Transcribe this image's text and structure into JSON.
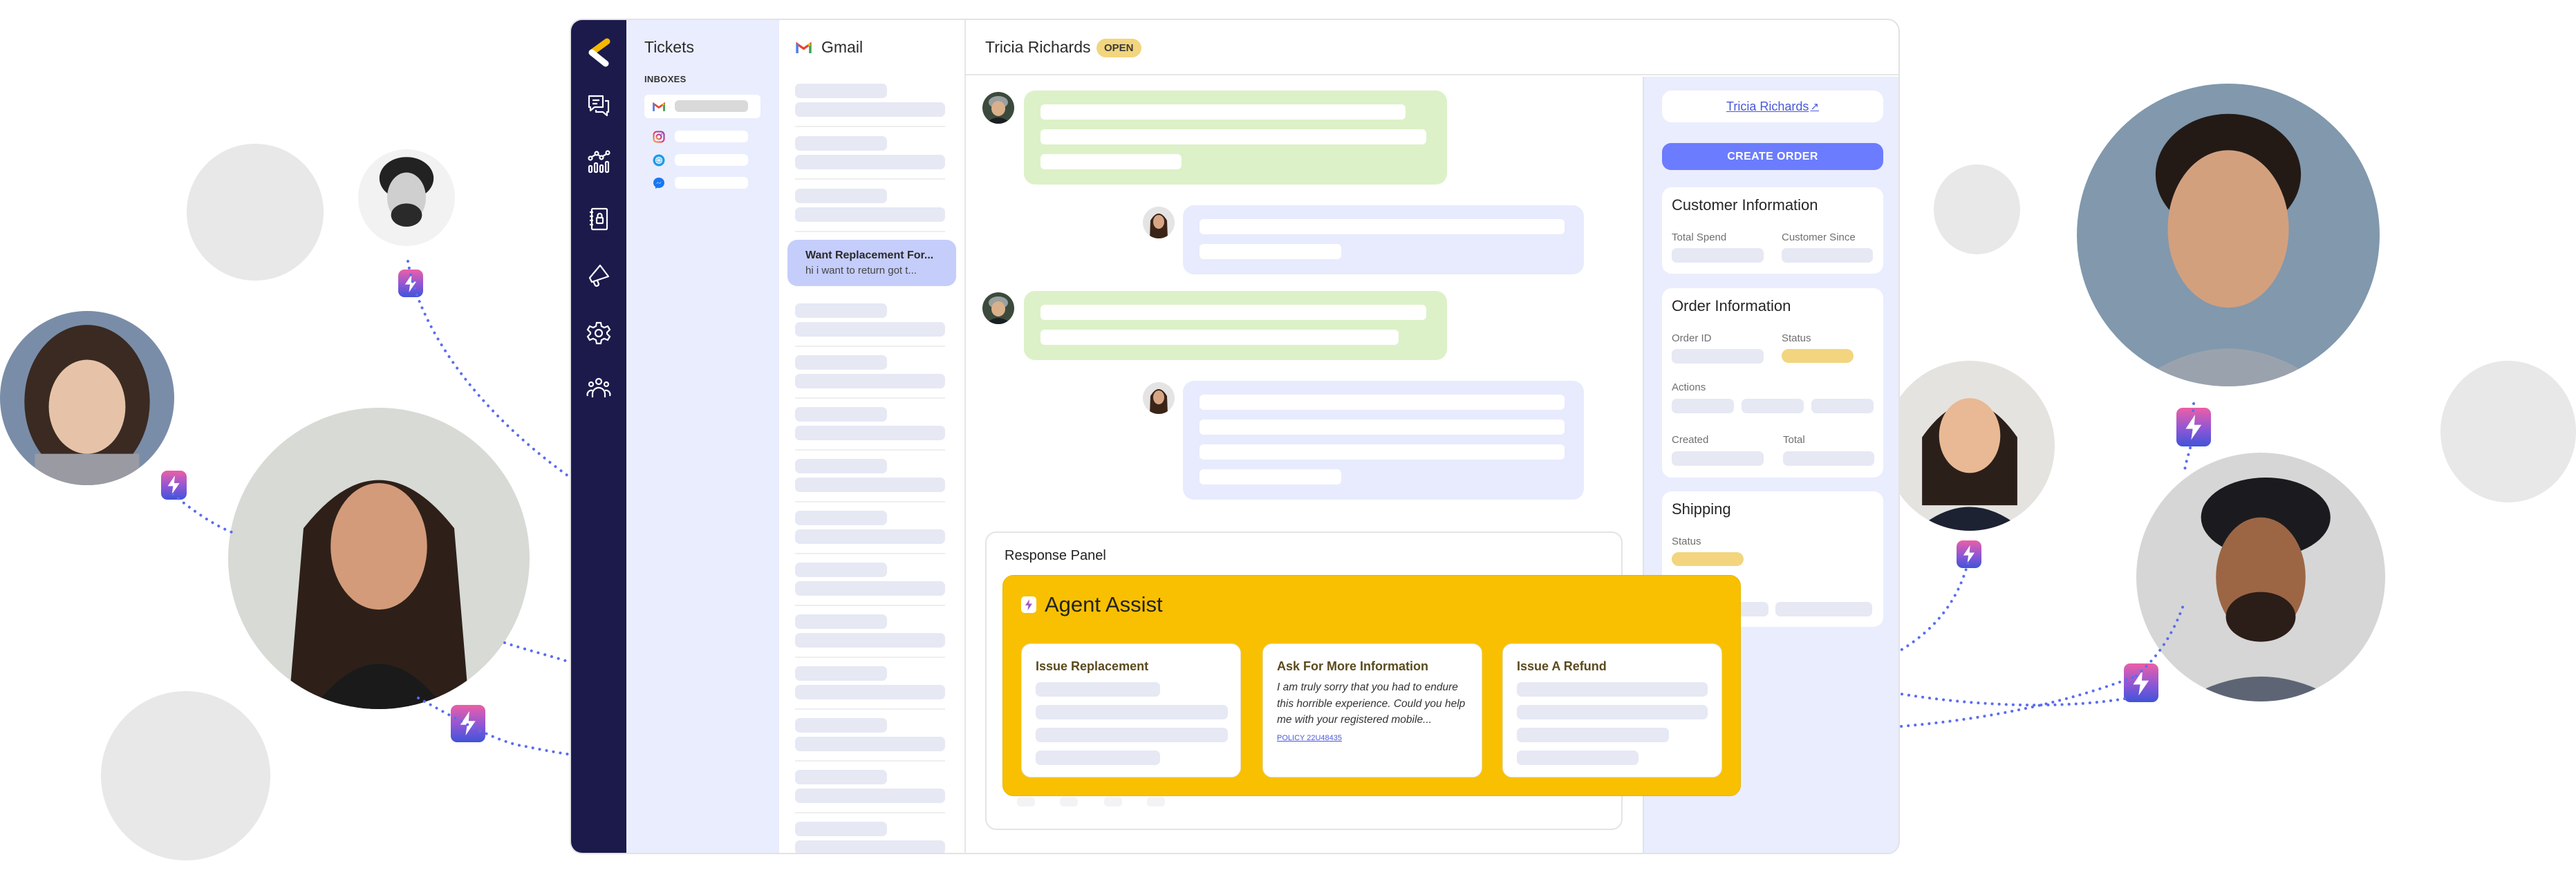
{
  "app": {
    "nav": {
      "items": [
        {
          "name": "conversations",
          "icon": "chat-icon"
        },
        {
          "name": "analytics",
          "icon": "analytics-icon"
        },
        {
          "name": "contacts",
          "icon": "contact-book-icon"
        },
        {
          "name": "campaigns",
          "icon": "megaphone-icon"
        },
        {
          "name": "settings",
          "icon": "gear-icon"
        },
        {
          "name": "team",
          "icon": "team-icon"
        }
      ]
    },
    "tickets": {
      "title": "Tickets",
      "inboxes_label": "INBOXES",
      "inboxes": [
        {
          "channel": "gmail",
          "icon": "gmail-icon",
          "active": true
        },
        {
          "channel": "instagram",
          "icon": "instagram-icon",
          "active": false
        },
        {
          "channel": "web",
          "icon": "globe-icon",
          "active": false
        },
        {
          "channel": "messenger",
          "icon": "messenger-icon",
          "active": false
        }
      ]
    },
    "list": {
      "title": "Gmail",
      "selected": {
        "subject": "Want Replacement For...",
        "preview": "hi i want to return got t..."
      }
    },
    "conversation": {
      "customer_name": "Tricia Richards",
      "status": "OPEN",
      "response_panel_title": "Response Panel"
    },
    "agent_assist": {
      "title": "Agent Assist",
      "cards": [
        {
          "title": "Issue Replacement"
        },
        {
          "title": "Ask For More Information",
          "body": "I am truly sorry that you had to endure this horrible experience. Could you help me with your registered mobile...",
          "policy": "POLICY 22U48435"
        },
        {
          "title": "Issue A Refund"
        }
      ]
    },
    "info_panel": {
      "customer_link": "Tricia Richards",
      "link_arrow": "↗",
      "create_order": "CREATE ORDER",
      "customer_info": {
        "title": "Customer Information",
        "total_spend_label": "Total Spend",
        "customer_since_label": "Customer Since"
      },
      "order_info": {
        "title": "Order Information",
        "order_id_label": "Order ID",
        "status_label": "Status",
        "actions_label": "Actions",
        "created_label": "Created",
        "total_label": "Total"
      },
      "shipping": {
        "title": "Shipping",
        "status_label": "Status"
      }
    }
  },
  "colors": {
    "nav_bg": "#1b1a4b",
    "panel_bg": "#eaedfd",
    "selected_ticket": "#c5cdfb",
    "status_badge": "#f2d57e",
    "agent_assist": "#f8c000",
    "primary_button": "#6b7cff",
    "connector": "#5a6cf0"
  }
}
